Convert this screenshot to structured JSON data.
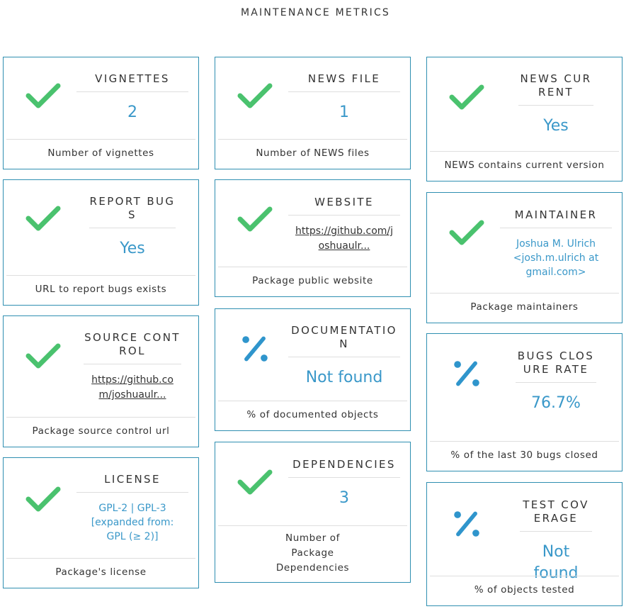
{
  "page_title": "MAINTENANCE METRICS",
  "colors": {
    "accent": "#3a98c9",
    "check": "#4ac26e",
    "percent": "#2f95cc",
    "border": "#2f8fb1"
  },
  "cards": {
    "vignettes": {
      "icon": "check-icon",
      "title": "VIGNETTES",
      "value": "2",
      "footer": "Number of vignettes"
    },
    "report_bugs": {
      "icon": "check-icon",
      "title": "REPORT BUGS",
      "value": "Yes",
      "footer": "URL to report bugs exists"
    },
    "source_control": {
      "icon": "check-icon",
      "title": "SOURCE CONTROL",
      "value": "https://github.com/joshuaulr...",
      "footer": "Package source control url"
    },
    "license": {
      "icon": "check-icon",
      "title": "LICENSE",
      "value": "GPL-2 | GPL-3 [expanded from: GPL (≥ 2)]",
      "footer": "Package's license"
    },
    "news_file": {
      "icon": "check-icon",
      "title": "NEWS FILE",
      "value": "1",
      "footer": "Number of NEWS files"
    },
    "website": {
      "icon": "check-icon",
      "title": "WEBSITE",
      "value": "https://github.com/joshuaulr...",
      "footer": "Package public website"
    },
    "documentation": {
      "icon": "percent-icon",
      "title": "DOCUMENTATION",
      "value": "Not found",
      "footer": "% of documented objects"
    },
    "dependencies": {
      "icon": "check-icon",
      "title": "DEPENDENCIES",
      "value": "3",
      "footer": "Number of Package Dependencies"
    },
    "news_current": {
      "icon": "check-icon",
      "title": "NEWS CURRENT",
      "value": "Yes",
      "footer": "NEWS contains current version"
    },
    "maintainer": {
      "icon": "check-icon",
      "title": "MAINTAINER",
      "value": "Joshua M. Ulrich <josh.m.ulrich at gmail.com>",
      "footer": "Package maintainers"
    },
    "bugs_closure_rate": {
      "icon": "percent-icon",
      "title": "BUGS CLOSURE RATE",
      "value": "76.7%",
      "footer": "% of the last 30 bugs closed"
    },
    "test_coverage": {
      "icon": "percent-icon",
      "title": "TEST COVERAGE",
      "value": "Not found",
      "footer": "% of objects tested"
    }
  }
}
